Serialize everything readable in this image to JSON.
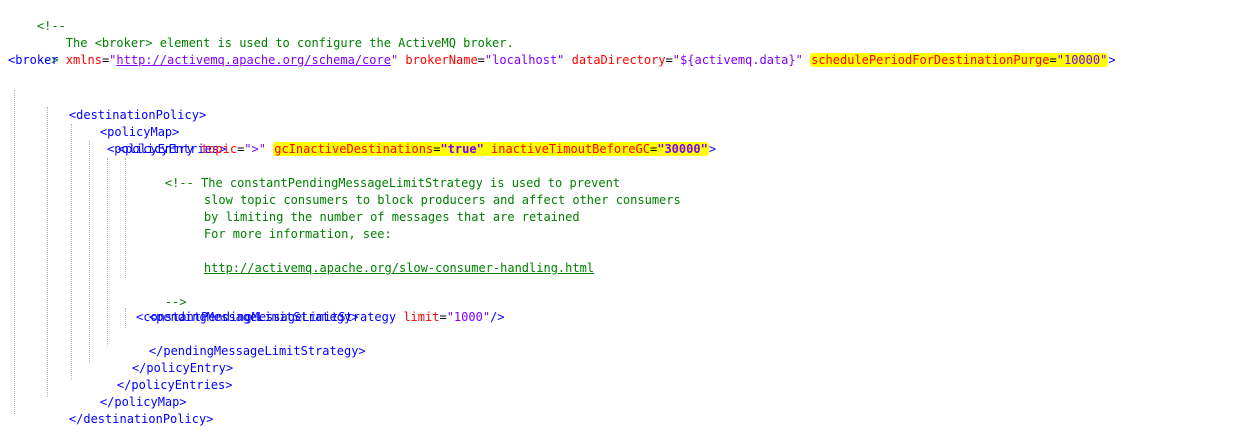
{
  "colors": {
    "tag": "#0000ff",
    "attribute": "#ff0000",
    "value": "#8000ff",
    "comment": "#008000",
    "highlight": "#ffff00"
  },
  "header_comment": {
    "open": "<!--",
    "text": "    The <broker> element is used to configure the ActiveMQ broker.",
    "close": "-->"
  },
  "broker": {
    "open": "<broker",
    "xmlns_attr": "xmlns",
    "xmlns_value": "http://activemq.apache.org/schema/core",
    "broker_name_attr": "brokerName",
    "broker_name_value": "localhost",
    "data_dir_attr": "dataDirectory",
    "data_dir_value": "${activemq.data}",
    "purge_attr": "schedulePeriodForDestinationPurge",
    "purge_value": "10000"
  },
  "destination_policy": {
    "open": "<destinationPolicy>",
    "close": "</destinationPolicy>"
  },
  "policy_map": {
    "open": "<policyMap>",
    "close": "</policyMap>"
  },
  "policy_entries": {
    "open": "<policyEntries>",
    "close": "</policyEntries>"
  },
  "policy_entry": {
    "open": "<policyEntry",
    "topic_attr": "topic",
    "topic_value": ">",
    "gc_attr": "gcInactiveDestinations",
    "gc_value": "true",
    "timeout_attr": "inactiveTimoutBeforeGC",
    "timeout_value": "30000",
    "close": "</policyEntry>"
  },
  "inner_comment": {
    "line1": "<!-- The constantPendingMessageLimitStrategy is used to prevent",
    "line2": "slow topic consumers to block producers and affect other consumers",
    "line3": "by limiting the number of messages that are retained",
    "line4": "For more information, see:",
    "url": "http://activemq.apache.org/slow-consumer-handling.html",
    "close": "-->"
  },
  "pending_strategy": {
    "open": "<pendingMessageLimitStrategy>",
    "close": "</pendingMessageLimitStrategy>"
  },
  "constant_strategy": {
    "open": "<constantPendingMessageLimitStrategy",
    "limit_attr": "limit",
    "limit_value": "1000",
    "close": "/>"
  }
}
